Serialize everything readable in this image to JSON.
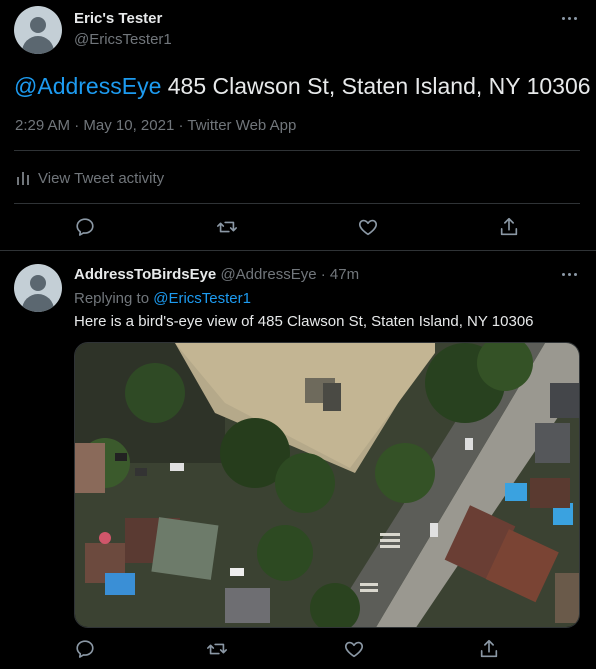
{
  "main_tweet": {
    "display_name": "Eric's Tester",
    "handle": "@EricsTester1",
    "mention": "@AddressEye",
    "text": " 485 Clawson St, Staten Island, NY 10306",
    "time": "2:29 AM",
    "date": "May 10, 2021",
    "source": "Twitter Web App",
    "activity_label": "View Tweet activity"
  },
  "reply_tweet": {
    "display_name": "AddressToBirdsEye",
    "handle": "@AddressEye",
    "age": "47m",
    "replying_prefix": "Replying to ",
    "replying_to": "@EricsTester1",
    "text": "Here is a bird's-eye view of 485 Clawson St, Staten Island, NY 10306"
  },
  "meta_separator": " · ",
  "icons": [
    "more-icon",
    "reply-icon",
    "retweet-icon",
    "like-icon",
    "share-icon",
    "activity-icon"
  ],
  "colors": {
    "background": "#000000",
    "accent": "#1d9bf0",
    "muted": "#71767b",
    "divider": "#2f3336"
  }
}
